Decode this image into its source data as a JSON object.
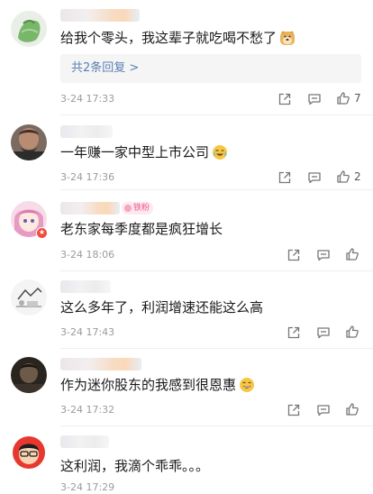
{
  "comments": [
    {
      "text": "给我个零头，我这辈子就吃喝不愁了",
      "emoji": "doge-icon",
      "reply_prefix": "共",
      "reply_count": "2",
      "reply_suffix": "条回复",
      "reply_arrow": ">",
      "date": "3-24",
      "time": "17:33",
      "likes": "7"
    },
    {
      "text": "一年赚一家中型上市公司",
      "emoji": "crying-laughing-icon",
      "date": "3-24",
      "time": "17:36",
      "likes": "2"
    },
    {
      "fan_tag": "铁粉",
      "text": "老东家每季度都是疯狂增长",
      "date": "3-24",
      "time": "18:06"
    },
    {
      "text": "这么多年了，利润增速还能这么高",
      "date": "3-24",
      "time": "17:43"
    },
    {
      "text": "作为迷你股东的我感到很恩惠",
      "emoji": "grinning-icon",
      "date": "3-24",
      "time": "17:32"
    },
    {
      "text": "这利润，我滴个乖乖。。。",
      "date": "3-24",
      "time": "17:29"
    }
  ]
}
